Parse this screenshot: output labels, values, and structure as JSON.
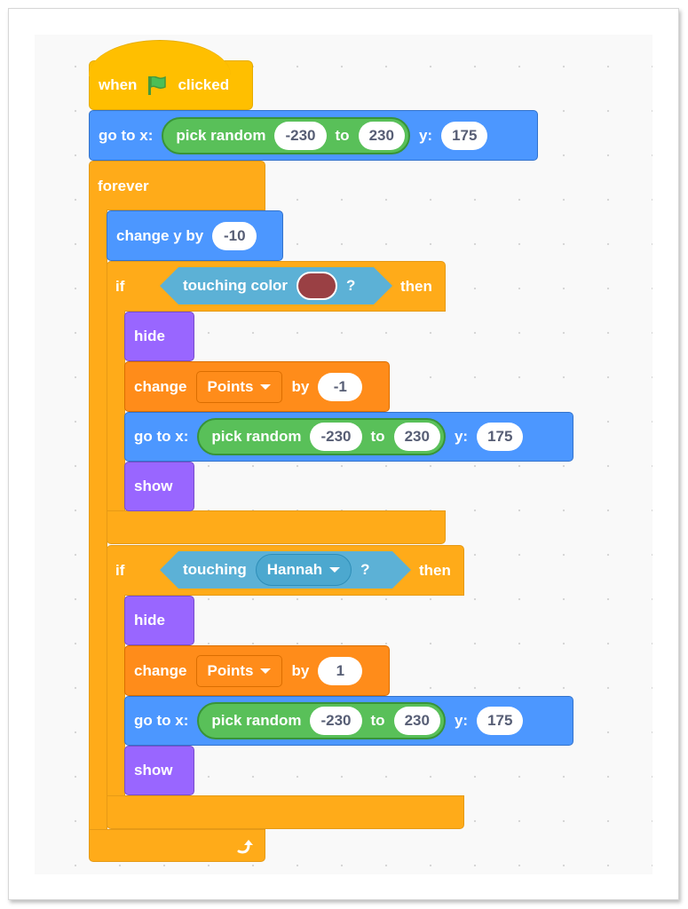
{
  "script": {
    "hat": {
      "when": "when",
      "flag_icon": "green-flag",
      "clicked": "clicked"
    },
    "goto_top": {
      "label": "go to x:",
      "random": "pick random",
      "from": "-230",
      "to_label": "to",
      "to": "230",
      "y_label": "y:",
      "y": "175"
    },
    "forever": {
      "label": "forever",
      "loop_icon": "loop-arrow"
    },
    "change_y": {
      "label": "change y by",
      "value": "-10"
    },
    "if1": {
      "if_label": "if",
      "condition": {
        "label": "touching color",
        "color": "#9a4044",
        "question": "?"
      },
      "then_label": "then",
      "hide": "hide",
      "change_var": {
        "label": "change",
        "variable": "Points",
        "by": "by",
        "value": "-1"
      },
      "goto": {
        "label": "go to x:",
        "random": "pick random",
        "from": "-230",
        "to_label": "to",
        "to": "230",
        "y_label": "y:",
        "y": "175"
      },
      "show": "show"
    },
    "if2": {
      "if_label": "if",
      "condition": {
        "label": "touching",
        "sprite": "Hannah",
        "question": "?"
      },
      "then_label": "then",
      "hide": "hide",
      "change_var": {
        "label": "change",
        "variable": "Points",
        "by": "by",
        "value": "1"
      },
      "goto": {
        "label": "go to x:",
        "random": "pick random",
        "from": "-230",
        "to_label": "to",
        "to": "230",
        "y_label": "y:",
        "y": "175"
      },
      "show": "show"
    }
  }
}
